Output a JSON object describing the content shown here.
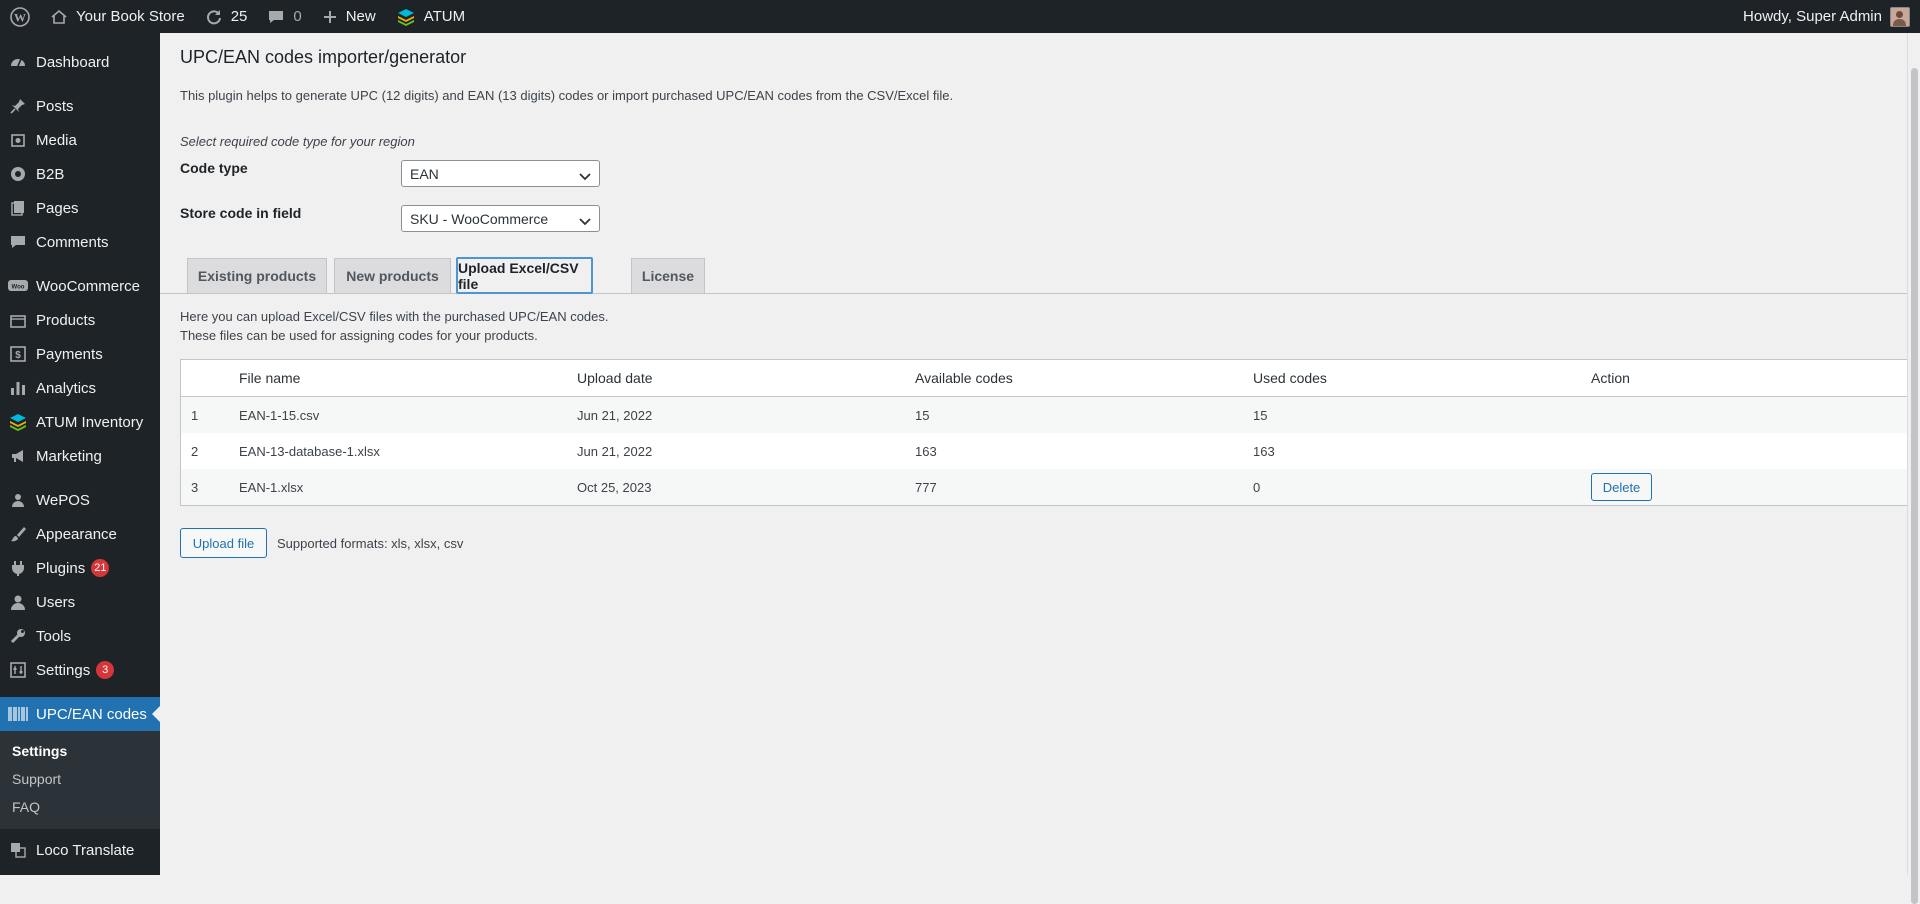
{
  "admin_bar": {
    "site_name": "Your Book Store",
    "updates_count": "25",
    "comments_count": "0",
    "new_label": "New",
    "atum_label": "ATUM",
    "greeting": "Howdy, Super Admin"
  },
  "sidebar": {
    "items": [
      {
        "label": "Dashboard",
        "icon": "dashboard-icon"
      },
      {
        "label": "Posts",
        "icon": "pin-icon"
      },
      {
        "label": "Media",
        "icon": "media-icon"
      },
      {
        "label": "B2B",
        "icon": "b2b-icon"
      },
      {
        "label": "Pages",
        "icon": "pages-icon"
      },
      {
        "label": "Comments",
        "icon": "comment-icon"
      },
      {
        "label": "WooCommerce",
        "icon": "woocommerce-icon"
      },
      {
        "label": "Products",
        "icon": "products-icon"
      },
      {
        "label": "Payments",
        "icon": "payments-icon"
      },
      {
        "label": "Analytics",
        "icon": "analytics-icon"
      },
      {
        "label": "ATUM Inventory",
        "icon": "atum-icon"
      },
      {
        "label": "Marketing",
        "icon": "megaphone-icon"
      },
      {
        "label": "WePOS",
        "icon": "wepos-icon"
      },
      {
        "label": "Appearance",
        "icon": "brush-icon"
      },
      {
        "label": "Plugins",
        "icon": "plugin-icon",
        "badge": "21"
      },
      {
        "label": "Users",
        "icon": "users-icon"
      },
      {
        "label": "Tools",
        "icon": "wrench-icon"
      },
      {
        "label": "Settings",
        "icon": "settings-icon",
        "badge": "3"
      },
      {
        "label": "UPC/EAN codes",
        "icon": "barcode-icon"
      },
      {
        "label": "Loco Translate",
        "icon": "translate-icon"
      }
    ],
    "submenu": [
      "Settings",
      "Support",
      "FAQ"
    ]
  },
  "page": {
    "title": "UPC/EAN codes importer/generator",
    "intro": "This plugin helps to generate UPC (12 digits) and EAN (13 digits) codes or import purchased UPC/EAN codes from the CSV/Excel file.",
    "region_hint": "Select required code type for your region",
    "code_type_label": "Code type",
    "code_type_value": "EAN",
    "store_field_label": "Store code in field",
    "store_field_value": "SKU - WooCommerce"
  },
  "tabs": [
    "Existing products",
    "New products",
    "Upload Excel/CSV file",
    "License"
  ],
  "upload": {
    "note_line1": "Here you can upload Excel/CSV files with the purchased UPC/EAN codes.",
    "note_line2": "These files can be used for assigning codes for your products.",
    "columns": [
      "File name",
      "Upload date",
      "Available codes",
      "Used codes",
      "Action"
    ],
    "rows": [
      {
        "n": "1",
        "file": "EAN-1-15.csv",
        "date": "Jun 21, 2022",
        "available": "15",
        "used": "15",
        "action": ""
      },
      {
        "n": "2",
        "file": "EAN-13-database-1.xlsx",
        "date": "Jun 21, 2022",
        "available": "163",
        "used": "163",
        "action": ""
      },
      {
        "n": "3",
        "file": "EAN-1.xlsx",
        "date": "Oct 25, 2023",
        "available": "777",
        "used": "0",
        "action": "Delete"
      }
    ],
    "upload_button": "Upload file",
    "formats": "Supported formats: xls, xlsx, csv"
  },
  "colors": {
    "admin_bar": "#1d2327",
    "accent": "#2271b1",
    "badge": "#d63638",
    "background": "#f0f0f1"
  }
}
